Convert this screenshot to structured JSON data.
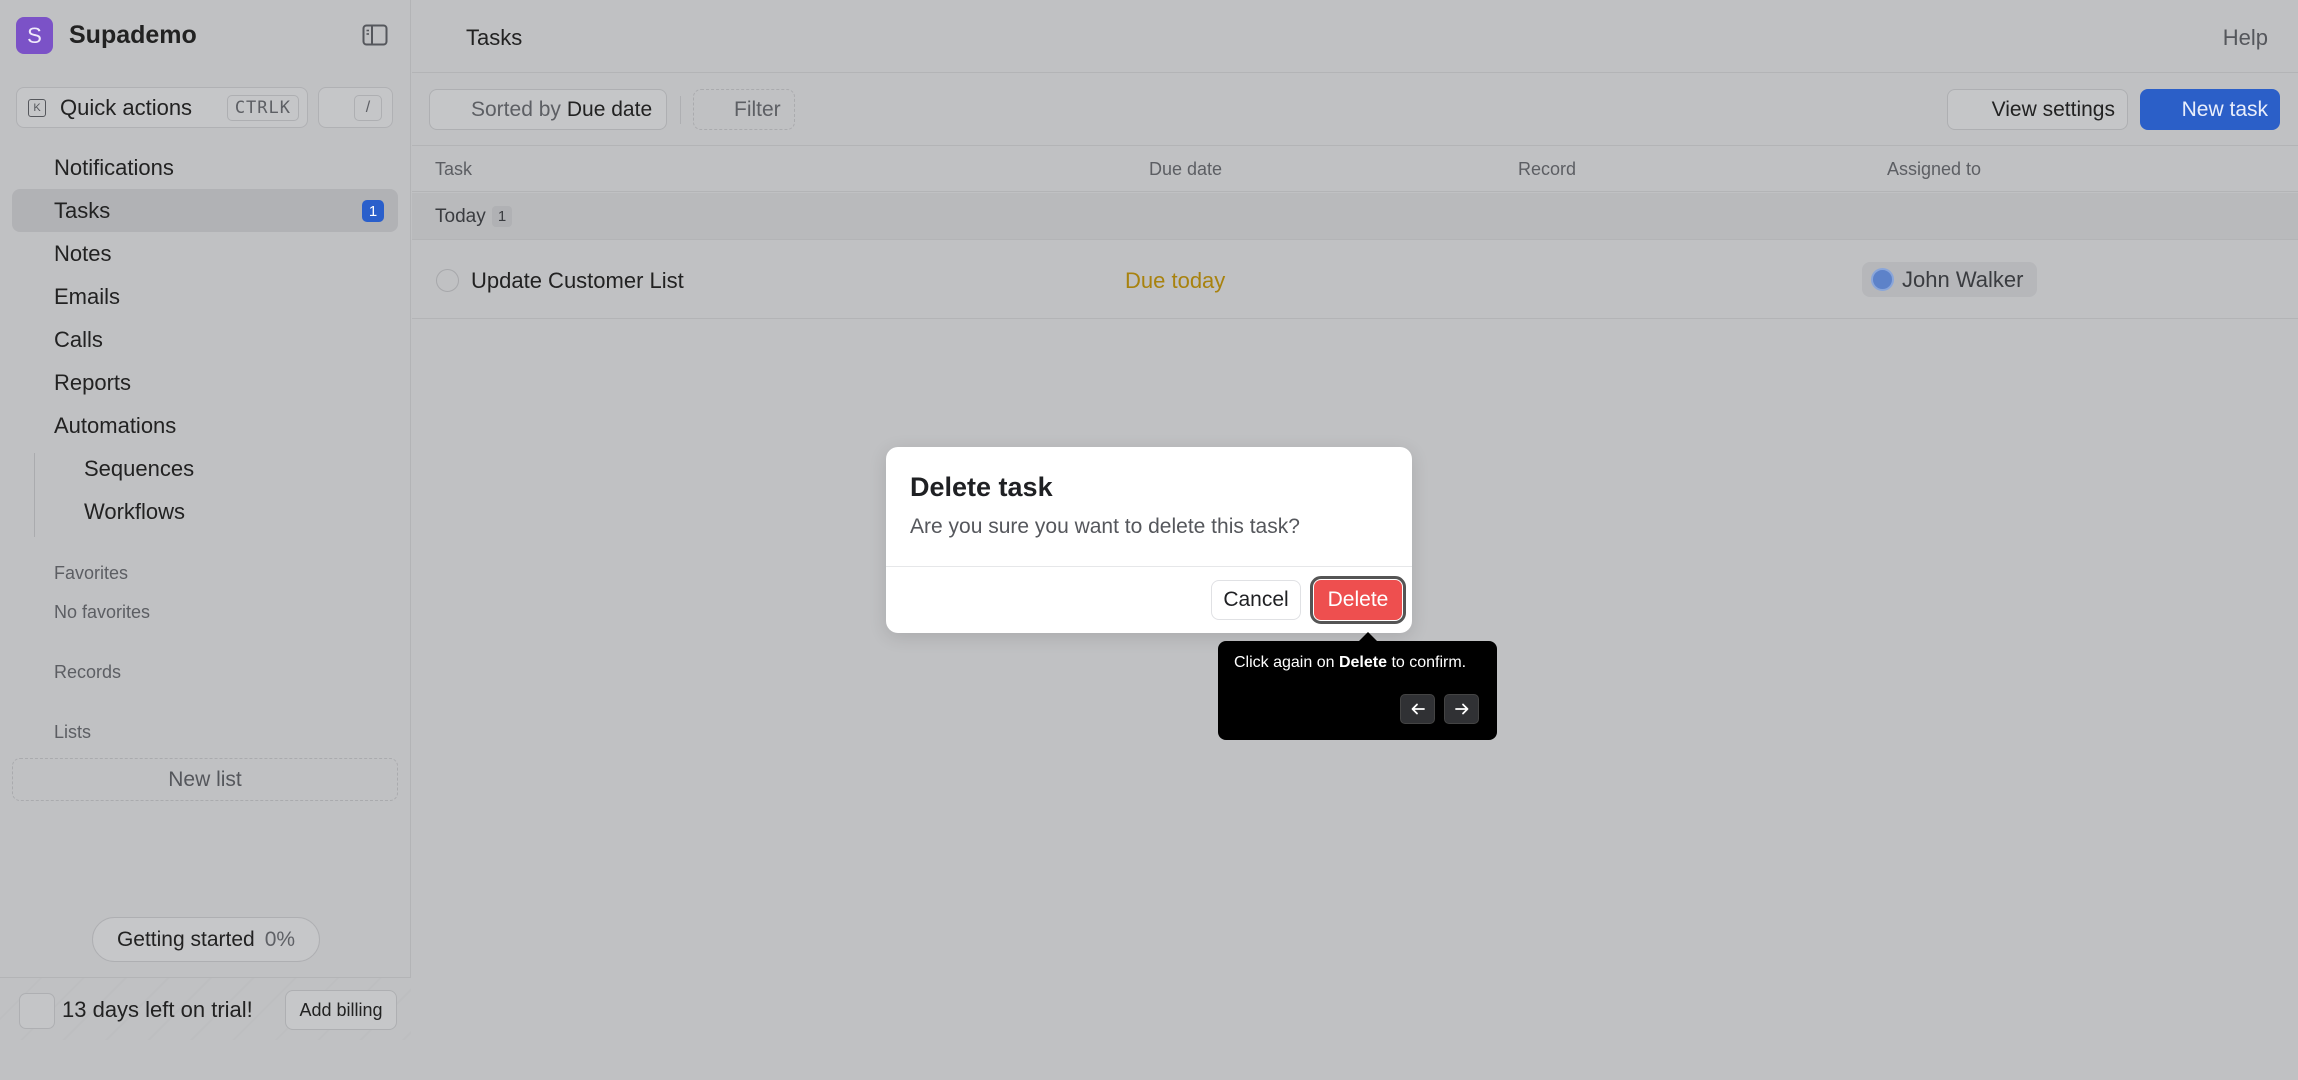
{
  "brand": {
    "logo_letter": "S",
    "name": "Supademo",
    "logo_color": "#7b52c7"
  },
  "quick_actions": {
    "label": "Quick actions",
    "shortcut": "CTRLK",
    "slash_key": "/"
  },
  "nav": {
    "items": [
      {
        "label": "Notifications"
      },
      {
        "label": "Tasks",
        "badge": "1",
        "active": true
      },
      {
        "label": "Notes"
      },
      {
        "label": "Emails"
      },
      {
        "label": "Calls"
      },
      {
        "label": "Reports"
      },
      {
        "label": "Automations"
      }
    ],
    "sub_items": [
      {
        "label": "Sequences"
      },
      {
        "label": "Workflows"
      }
    ]
  },
  "favorites": {
    "title": "Favorites",
    "empty": "No favorites"
  },
  "records": {
    "title": "Records"
  },
  "lists": {
    "title": "Lists",
    "new_list": "New list"
  },
  "getting_started": {
    "label": "Getting started",
    "progress": "0%"
  },
  "trial": {
    "text": "13 days left on trial!",
    "billing_button": "Add billing"
  },
  "header": {
    "title": "Tasks",
    "help": "Help"
  },
  "toolbar": {
    "sort_prefix": "Sorted by",
    "sort_value": "Due date",
    "filter": "Filter",
    "view_settings": "View settings",
    "new_task": "New task",
    "accent": "#2b5fc8"
  },
  "table": {
    "columns": [
      "Task",
      "Due date",
      "Record",
      "Assigned to"
    ],
    "group": {
      "label": "Today",
      "count": "1"
    },
    "rows": [
      {
        "task": "Update Customer List",
        "due": "Due today",
        "record": "",
        "assignee": "John Walker"
      }
    ]
  },
  "modal": {
    "title": "Delete task",
    "description": "Are you sure you want to delete this task?",
    "cancel": "Cancel",
    "delete": "Delete",
    "delete_color": "#ee4f4f"
  },
  "tooltip": {
    "text_before": "Click again on",
    "text_bold": "Delete",
    "text_after": "to confirm.",
    "prev_icon": "arrow-left-icon",
    "next_icon": "arrow-right-icon"
  }
}
